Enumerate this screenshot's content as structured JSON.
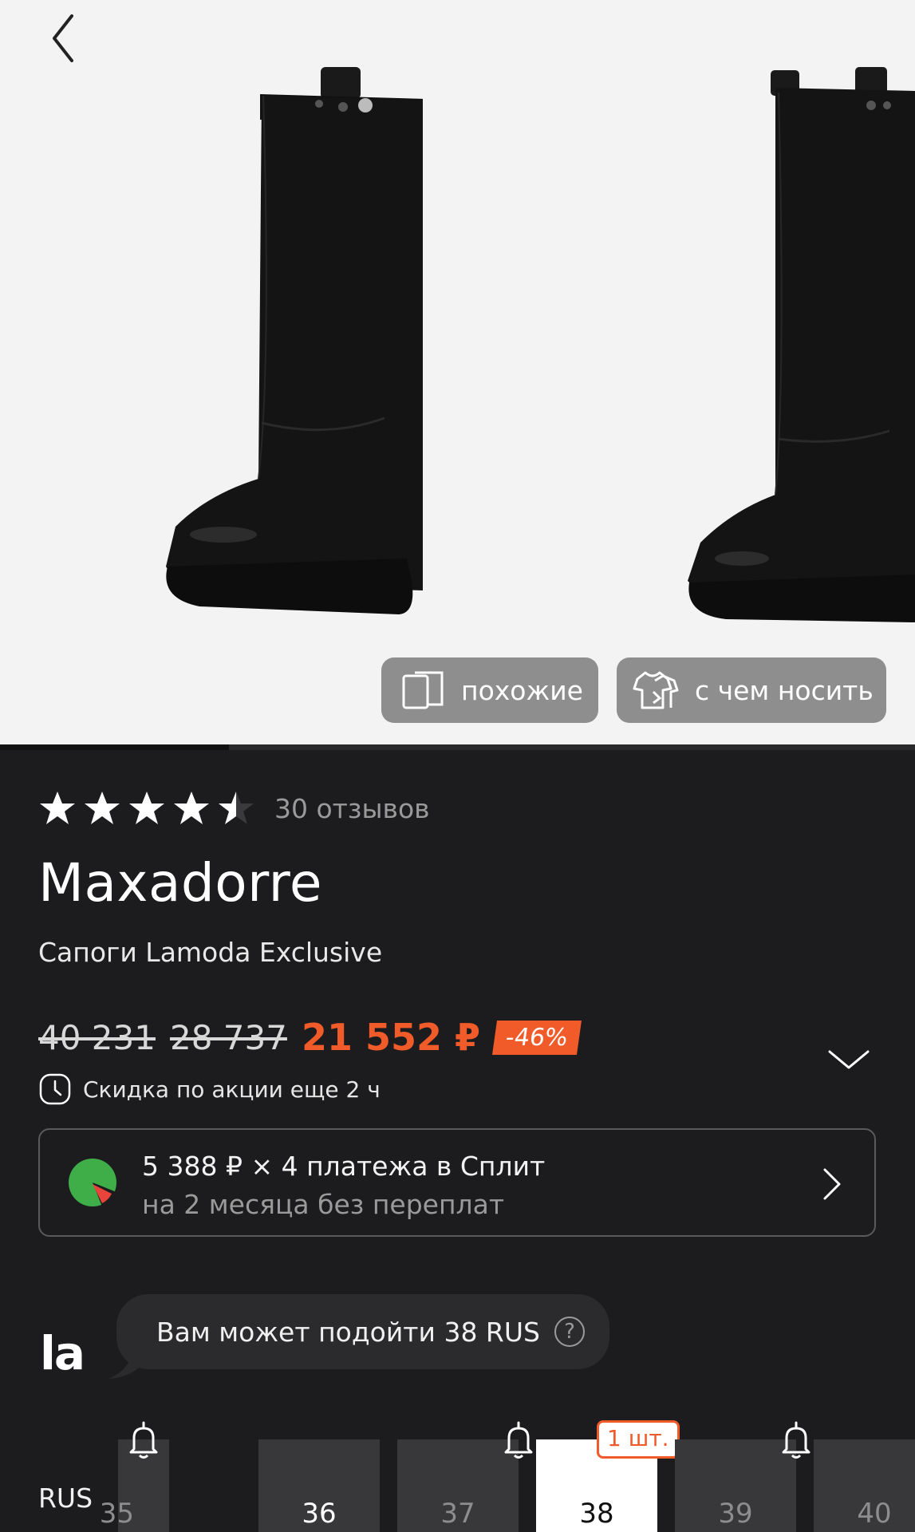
{
  "gallery": {
    "buttons": {
      "similar": "похожие",
      "outfit": "с чем носить"
    },
    "progress": 0.25
  },
  "rating": {
    "stars": 4.5,
    "reviews": "30 отзывов"
  },
  "product": {
    "brand": "Maxadorre",
    "title": "Сапоги Lamoda Exclusive"
  },
  "price": {
    "old1": "40 231",
    "old2": "28 737",
    "current": "21 552 ₽",
    "discount": "-46%",
    "promo": "Скидка по акции еще 2 ч"
  },
  "split": {
    "line1": "5 388 ₽ × 4 платежа в Сплит",
    "line2": "на 2 месяца без переплат"
  },
  "assistant": {
    "logo": "la",
    "text": "Вам может подойти 38 RUS",
    "help": "?"
  },
  "sizes": {
    "system": "RUS",
    "items": [
      {
        "label": "35",
        "state": "na"
      },
      {
        "label": "36",
        "state": "avail"
      },
      {
        "label": "37",
        "state": "na"
      },
      {
        "label": "38",
        "state": "selected",
        "qty": "1 шт."
      },
      {
        "label": "39",
        "state": "na"
      },
      {
        "label": "40",
        "state": "na"
      }
    ]
  },
  "colors": {
    "accent": "#f15a29",
    "background": "#1c1c1e",
    "gallery_bg": "#f3f3f3"
  },
  "icons": [
    "back-chevron-icon",
    "similar-cards-icon",
    "outfit-icon",
    "star-icon",
    "clock-icon",
    "chevron-down-icon",
    "split-logo-icon",
    "chevron-right-icon",
    "help-icon",
    "bell-icon"
  ]
}
